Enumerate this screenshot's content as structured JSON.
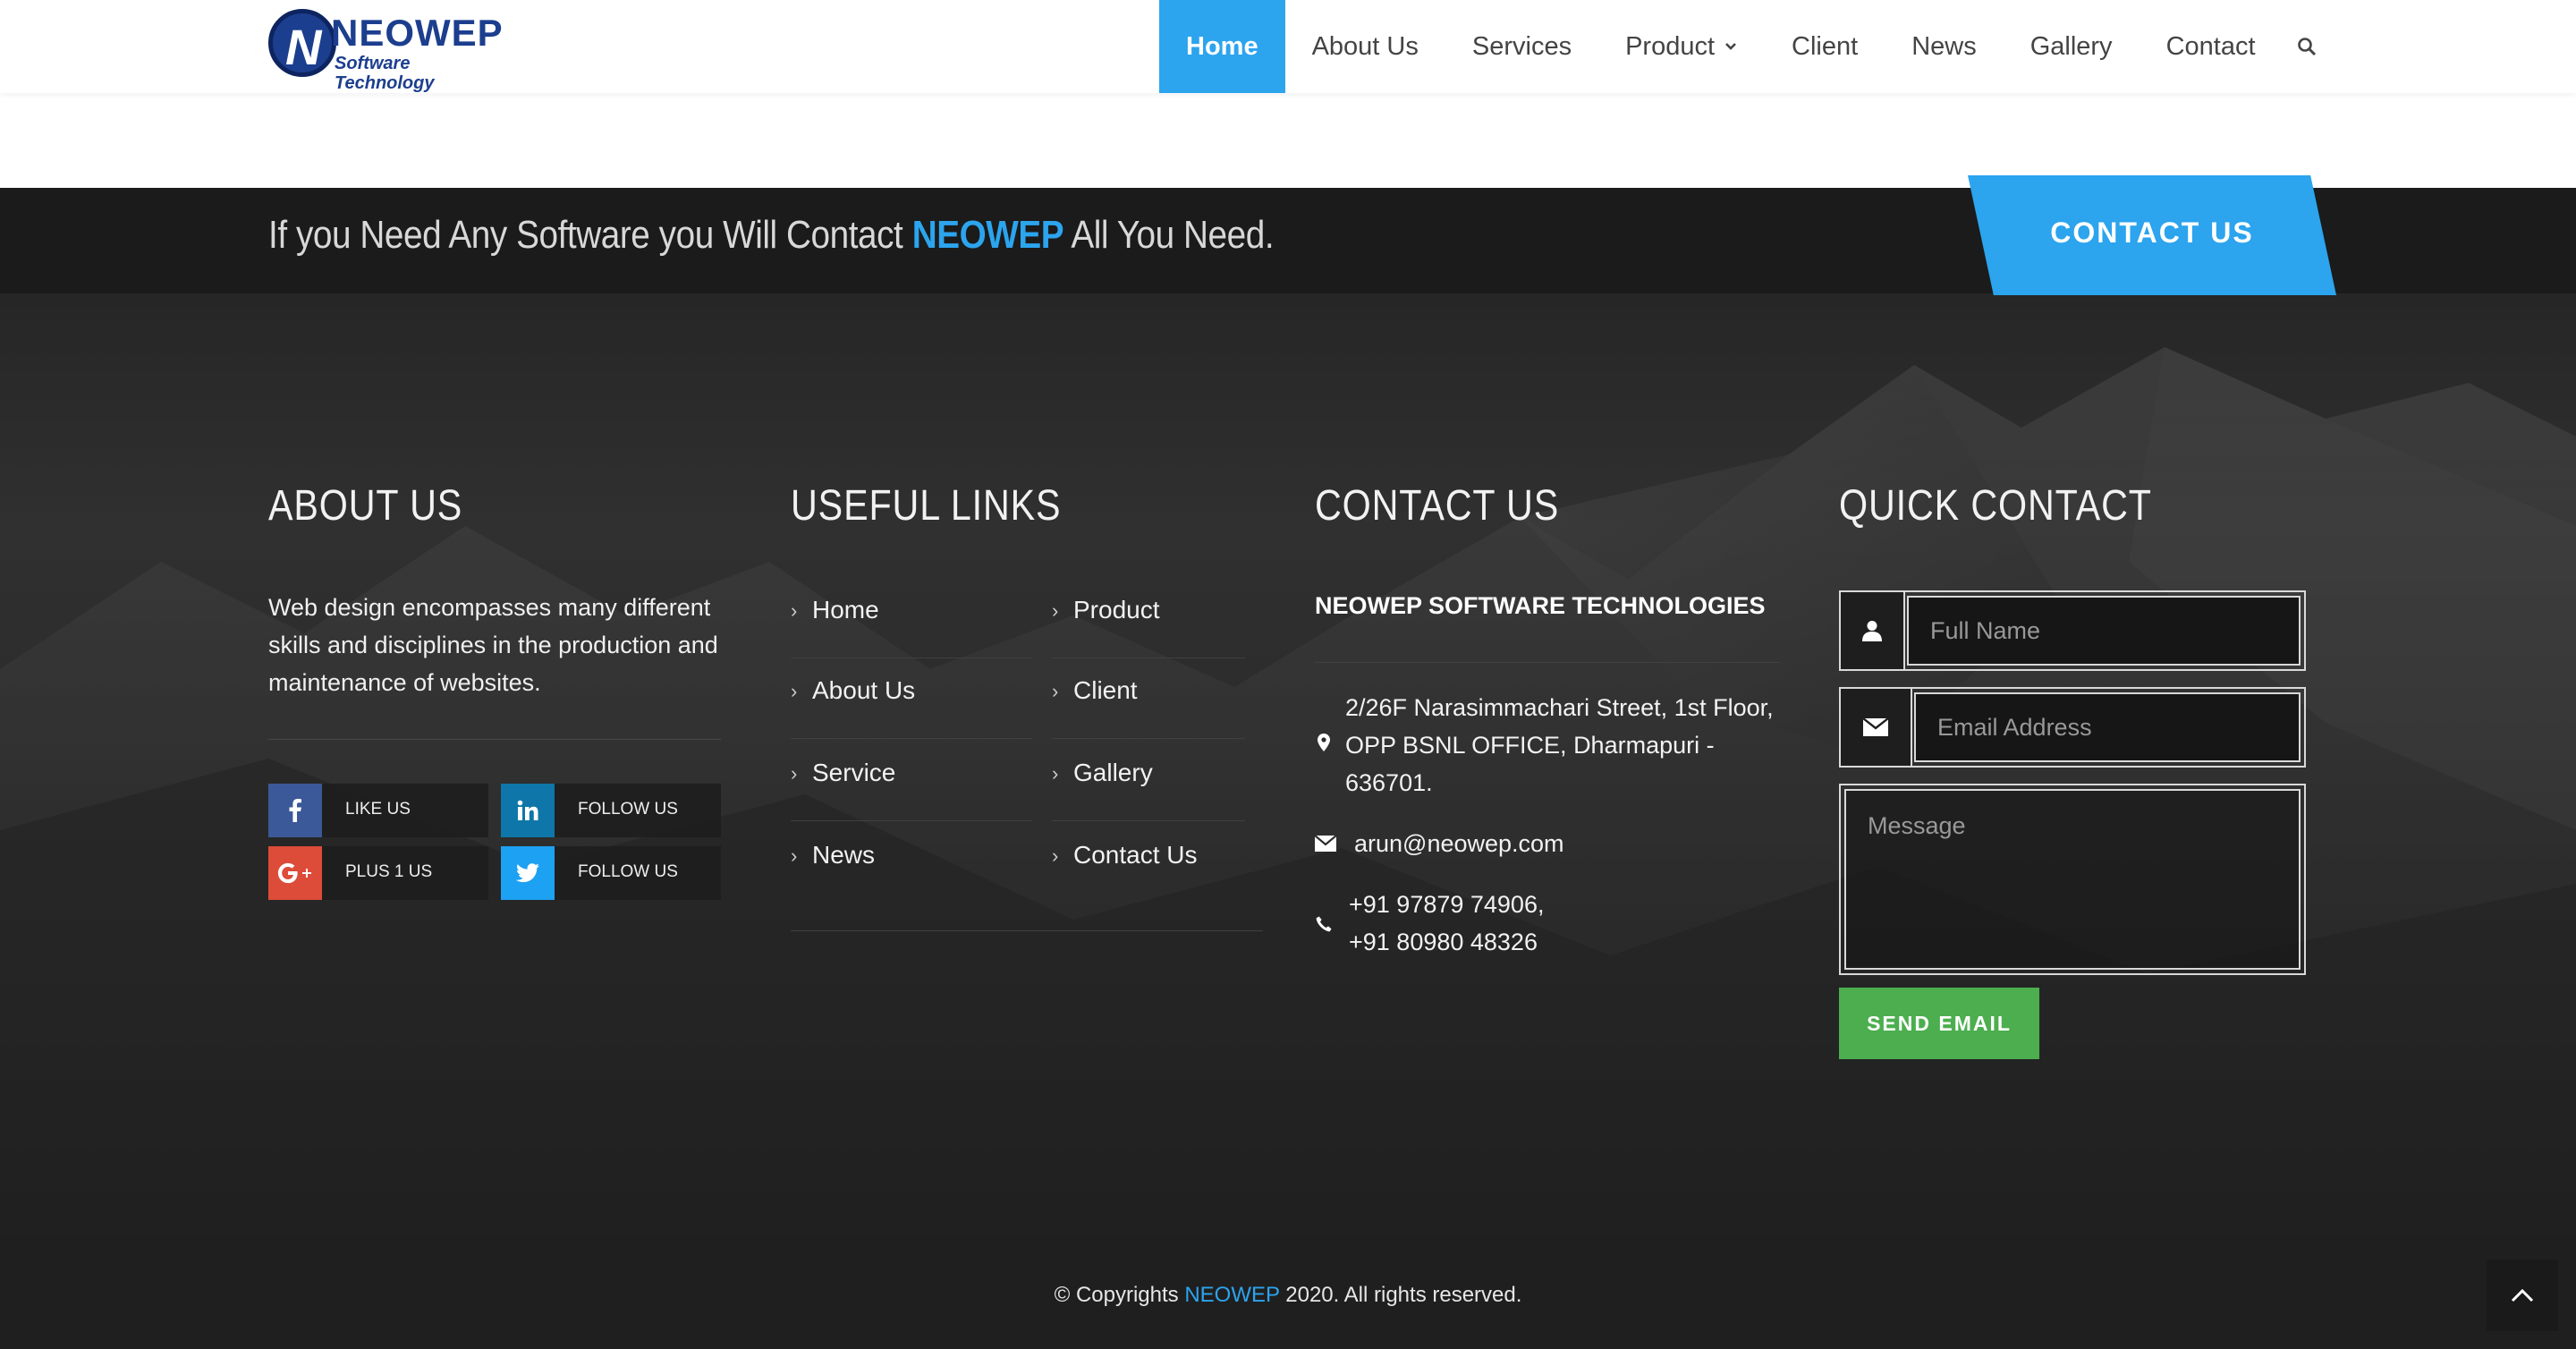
{
  "header": {
    "logo_letter": "N",
    "logo_word": "NEOWEP",
    "logo_sub": "Software Technology",
    "nav": [
      "Home",
      "About Us",
      "Services",
      "Product",
      "Client",
      "News",
      "Gallery",
      "Contact"
    ],
    "active_nav": "Home"
  },
  "cta": {
    "text_before": "If you Need Any Software you Will Contact",
    "brand": "NEOWEP",
    "text_after": "All You Need.",
    "button": "CONTACT US"
  },
  "about": {
    "title": "ABOUT US",
    "text": "Web design encompasses many different skills and disciplines in the production and maintenance of websites.",
    "social": [
      {
        "icon": "facebook-icon",
        "glyph": "f",
        "label": "LIKE US",
        "color": "#3b5998"
      },
      {
        "icon": "linkedin-icon",
        "glyph": "in",
        "label": "FOLLOW US",
        "color": "#0e76a8"
      },
      {
        "icon": "google-plus-icon",
        "glyph": "G+",
        "label": "PLUS 1 US",
        "color": "#dd4b39"
      },
      {
        "icon": "twitter-icon",
        "glyph": "t",
        "label": "FOLLOW US",
        "color": "#1da1f2"
      }
    ]
  },
  "links": {
    "title": "USEFUL LINKS",
    "col1": [
      "Home",
      "About Us",
      "Service",
      "News"
    ],
    "col2": [
      "Product",
      "Client",
      "Gallery",
      "Contact Us"
    ]
  },
  "contact": {
    "title": "CONTACT US",
    "company": "NEOWEP SOFTWARE TECHNOLOGIES",
    "address_lines": [
      "2/26F Narasimmachari Street, 1st Floor,",
      "OPP BSNL OFFICE, Dharmapuri -",
      "636701."
    ],
    "email": "arun@neowep.com",
    "phones": [
      "+91 97879 74906,",
      "+91 80980 48326"
    ]
  },
  "quick": {
    "title": "QUICK CONTACT",
    "name_placeholder": "Full Name",
    "email_placeholder": "Email Address",
    "message_placeholder": "Message",
    "send": "SEND EMAIL"
  },
  "footer": {
    "copy_before": "© Copyrights",
    "brand": "NEOWEP",
    "copy_after": "2020. All rights reserved."
  },
  "colors": {
    "accent": "#2ca4ee",
    "send": "#4cae4f",
    "dark": "#1b1b1b"
  }
}
